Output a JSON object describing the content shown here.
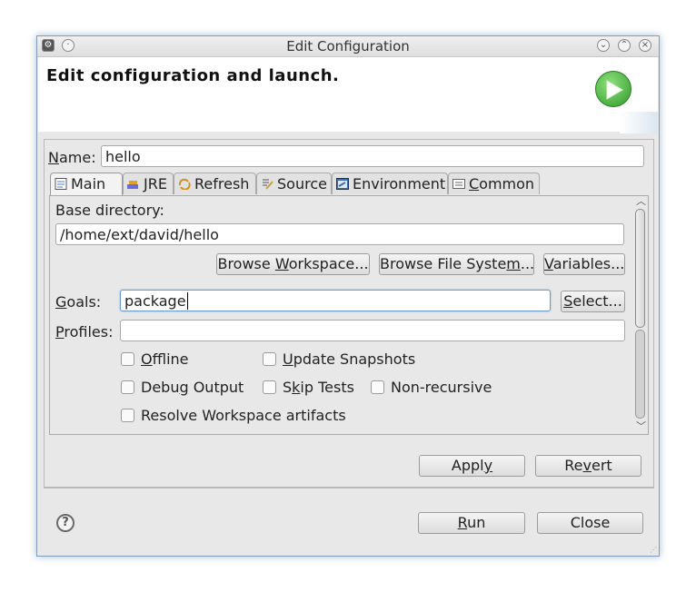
{
  "window": {
    "title": "Edit Configuration",
    "header_heading": "Edit configuration and launch."
  },
  "name_field": {
    "label_mnemonic": "N",
    "label_rest": "ame:",
    "value": "hello"
  },
  "tabs": [
    {
      "label": "Main",
      "icon": "main-tab-icon",
      "active": true
    },
    {
      "label": "JRE",
      "icon": "jre-tab-icon"
    },
    {
      "label": "Refresh",
      "icon": "refresh-tab-icon"
    },
    {
      "label": "Source",
      "icon": "source-tab-icon"
    },
    {
      "label": "Environment",
      "icon": "environment-tab-icon"
    },
    {
      "label_mnemonic": "C",
      "label_rest": "ommon",
      "icon": "common-tab-icon"
    }
  ],
  "main_tab": {
    "base_directory_label": "Base directory:",
    "base_directory_value": "/home/ext/david/hello",
    "browse_workspace": {
      "pre": "Browse ",
      "mnemonic": "W",
      "post": "orkspace..."
    },
    "browse_file_system": {
      "pre": "Browse File Syste",
      "mnemonic": "m",
      "post": "..."
    },
    "variables": {
      "mnemonic": "V",
      "post": "ariables..."
    },
    "goals": {
      "label_mnemonic": "G",
      "label_rest": "oals:",
      "value": "package"
    },
    "select_button": {
      "mnemonic": "S",
      "post": "elect..."
    },
    "profiles": {
      "label_mnemonic": "P",
      "label_rest": "rofiles:",
      "value": ""
    },
    "checkboxes": {
      "offline": {
        "mnemonic": "O",
        "rest": "ffline",
        "checked": false
      },
      "update_snapshots": {
        "mnemonic": "U",
        "rest": "pdate Snapshots",
        "checked": false
      },
      "debug_output": {
        "pre": "Debu",
        "mnemonic": "g",
        "post": " Output",
        "checked": false
      },
      "skip_tests": {
        "pre": "S",
        "mnemonic": "k",
        "post": "ip Tests",
        "checked": false
      },
      "non_recursive": {
        "label": "Non-recursive",
        "checked": false
      },
      "resolve_workspace": {
        "label": "Resolve Workspace artifacts",
        "checked": false
      }
    }
  },
  "buttons": {
    "apply": {
      "pre": "Appl",
      "mnemonic": "y",
      "post": ""
    },
    "revert": {
      "pre": "Re",
      "mnemonic": "v",
      "post": "ert"
    },
    "run": {
      "mnemonic": "R",
      "post": "un"
    },
    "close": {
      "label": "Close"
    }
  },
  "colors": {
    "window_bg": "#e8e8e8",
    "run_icon_green": "#3aa835",
    "focus_border": "#6e9bc7"
  }
}
